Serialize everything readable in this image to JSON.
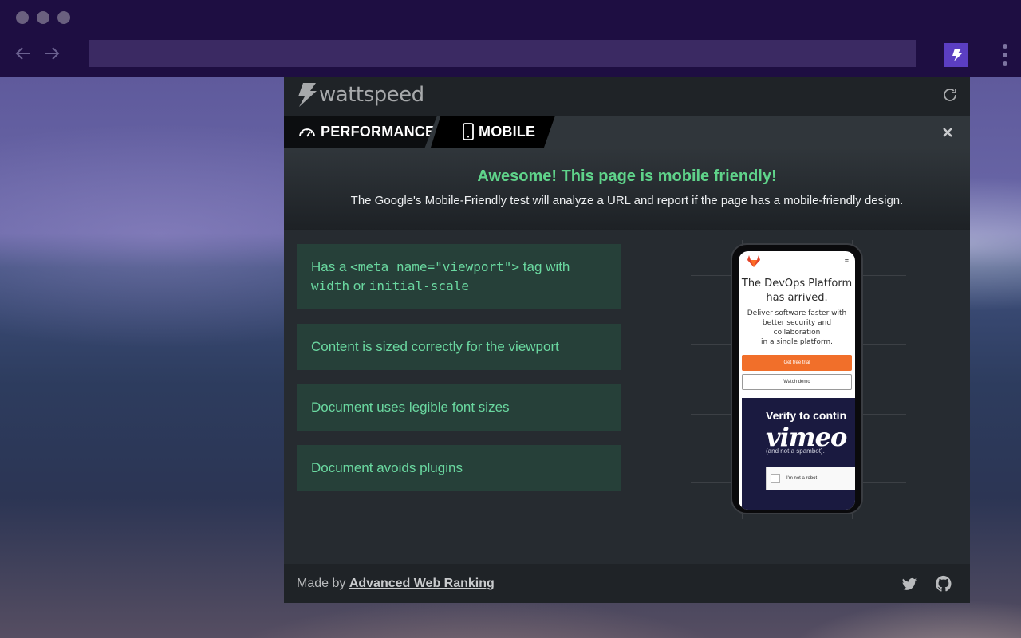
{
  "chrome": {
    "back_icon": "arrow-left-icon",
    "forward_icon": "arrow-right-icon",
    "url": "",
    "extension_icon": "lightning-icon",
    "menu_icon": "kebab-menu-icon"
  },
  "popup": {
    "logo_text": "wattspeed",
    "refresh_icon": "refresh-icon",
    "tabs": [
      {
        "label": "PERFORMANCE",
        "icon": "speedometer-icon",
        "active": false
      },
      {
        "label": "MOBILE",
        "icon": "phone-icon",
        "active": true
      }
    ],
    "close_icon": "close-icon",
    "banner": {
      "title": "Awesome! This page is mobile friendly!",
      "description": "The Google's Mobile-Friendly test will analyze a URL and report if the page has a mobile-friendly design."
    },
    "checks": {
      "viewport": {
        "pre": "Has a ",
        "code1": "<meta name=\"viewport\">",
        "mid": " tag with",
        "code2": "width",
        "or": " or ",
        "code3": "initial-scale"
      },
      "sized": "Content is sized correctly for the viewport",
      "legible": "Document uses legible font sizes",
      "plugins": "Document avoids plugins"
    },
    "preview": {
      "title_line1": "The DevOps Platform",
      "title_line2": "has arrived.",
      "sub_line1": "Deliver software faster with",
      "sub_line2": "better security and collaboration",
      "sub_line3": "in a single platform.",
      "primary_button": "Get free trial",
      "secondary_button": "Watch demo",
      "captcha_title": "Verify to contin",
      "captcha_brand": "vimeo",
      "captcha_text": "(and not a spambot).",
      "captcha_checkbox": "I'm not a robot"
    },
    "footer": {
      "made_by": "Made by ",
      "link": "Advanced Web Ranking",
      "twitter_icon": "twitter-icon",
      "github_icon": "github-icon"
    }
  },
  "colors": {
    "accent_green": "#5fd38a",
    "check_bg": "#264039",
    "chrome_bg": "#1e0e42",
    "extension_accent": "#5b3ec2"
  }
}
